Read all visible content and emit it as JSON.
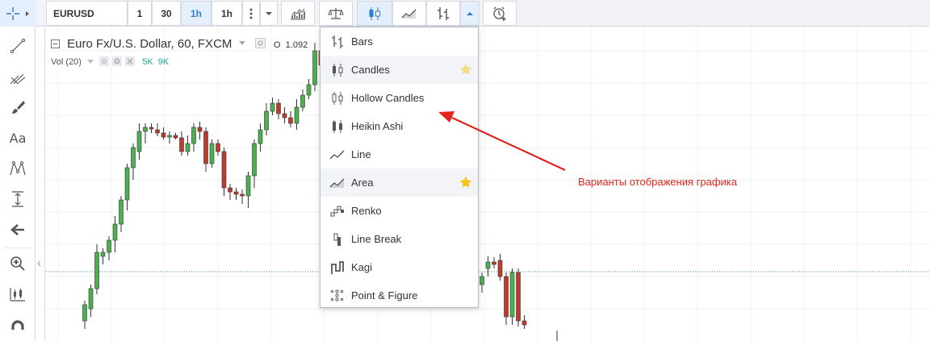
{
  "toolbar": {
    "symbol": "EURUSD",
    "intervals": [
      "1",
      "30",
      "1h",
      "1h"
    ],
    "active_interval_index": 2
  },
  "legend": {
    "title": "Euro Fx/U.S. Dollar, 60, FXCM",
    "open_label": "O",
    "open_value": "1.092",
    "volume_label": "Vol (20)",
    "volume_values": [
      "5K",
      "9K"
    ]
  },
  "chart_types": {
    "items": [
      {
        "label": "Bars",
        "icon": "bars-icon",
        "favorite": false,
        "highlighted": false
      },
      {
        "label": "Candles",
        "icon": "candles-icon",
        "favorite": true,
        "favorite_active": false,
        "highlighted": true
      },
      {
        "label": "Hollow Candles",
        "icon": "hollow-candles-icon",
        "favorite": false,
        "highlighted": false
      },
      {
        "label": "Heikin Ashi",
        "icon": "heikin-ashi-icon",
        "favorite": false,
        "highlighted": false
      },
      {
        "label": "Line",
        "icon": "line-icon",
        "favorite": false,
        "highlighted": false
      },
      {
        "label": "Area",
        "icon": "area-icon",
        "favorite": true,
        "favorite_active": true,
        "highlighted": true
      },
      {
        "label": "Renko",
        "icon": "renko-icon",
        "favorite": false,
        "highlighted": false
      },
      {
        "label": "Line Break",
        "icon": "line-break-icon",
        "favorite": false,
        "highlighted": false
      },
      {
        "label": "Kagi",
        "icon": "kagi-icon",
        "favorite": false,
        "highlighted": false
      },
      {
        "label": "Point & Figure",
        "icon": "point-figure-icon",
        "favorite": false,
        "highlighted": false
      }
    ]
  },
  "annotation": {
    "text": "Варианты отображения графика",
    "color": "#e3241b"
  },
  "colors": {
    "up_candle": "#4caf50",
    "down_candle": "#c0392b",
    "accent": "#2e7bcf",
    "star_active": "#f5c518",
    "star_inactive": "#f2dc8a"
  }
}
